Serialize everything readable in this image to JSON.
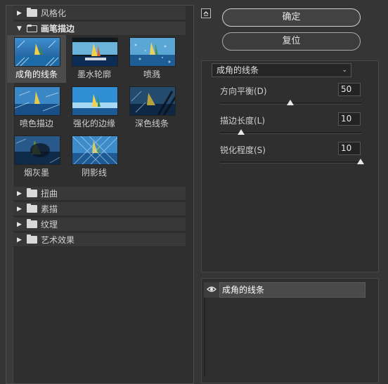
{
  "gallery": {
    "categories_top": [
      {
        "label": "风格化",
        "open": false
      },
      {
        "label": "画笔描边",
        "open": true
      }
    ],
    "thumbnails": [
      {
        "label": "成角的线条",
        "selected": true
      },
      {
        "label": "墨水轮廓",
        "selected": false
      },
      {
        "label": "喷溅",
        "selected": false
      },
      {
        "label": "喷色描边",
        "selected": false
      },
      {
        "label": "强化的边缘",
        "selected": false
      },
      {
        "label": "深色线条",
        "selected": false
      },
      {
        "label": "烟灰墨",
        "selected": false
      },
      {
        "label": "阴影线",
        "selected": false
      }
    ],
    "categories_bottom": [
      {
        "label": "扭曲"
      },
      {
        "label": "素描"
      },
      {
        "label": "纹理"
      },
      {
        "label": "艺术效果"
      }
    ]
  },
  "buttons": {
    "ok_label": "确定",
    "reset_label": "复位"
  },
  "filter_select": {
    "value": "成角的线条"
  },
  "params": [
    {
      "label": "方向平衡(D)",
      "value": "50",
      "fraction": 0.5
    },
    {
      "label": "描边长度(L)",
      "value": "10",
      "fraction": 0.2
    },
    {
      "label": "锐化程度(S)",
      "value": "10",
      "fraction": 1.0
    }
  ],
  "layers": {
    "active_layer": "成角的线条"
  },
  "icons": {
    "collapse": "collapse-panel-icon",
    "eye": "eye-icon",
    "folder": "folder-icon",
    "expand": "triangle-right-icon",
    "collapse_tri": "triangle-down-icon",
    "chevron": "chevron-down-icon"
  }
}
